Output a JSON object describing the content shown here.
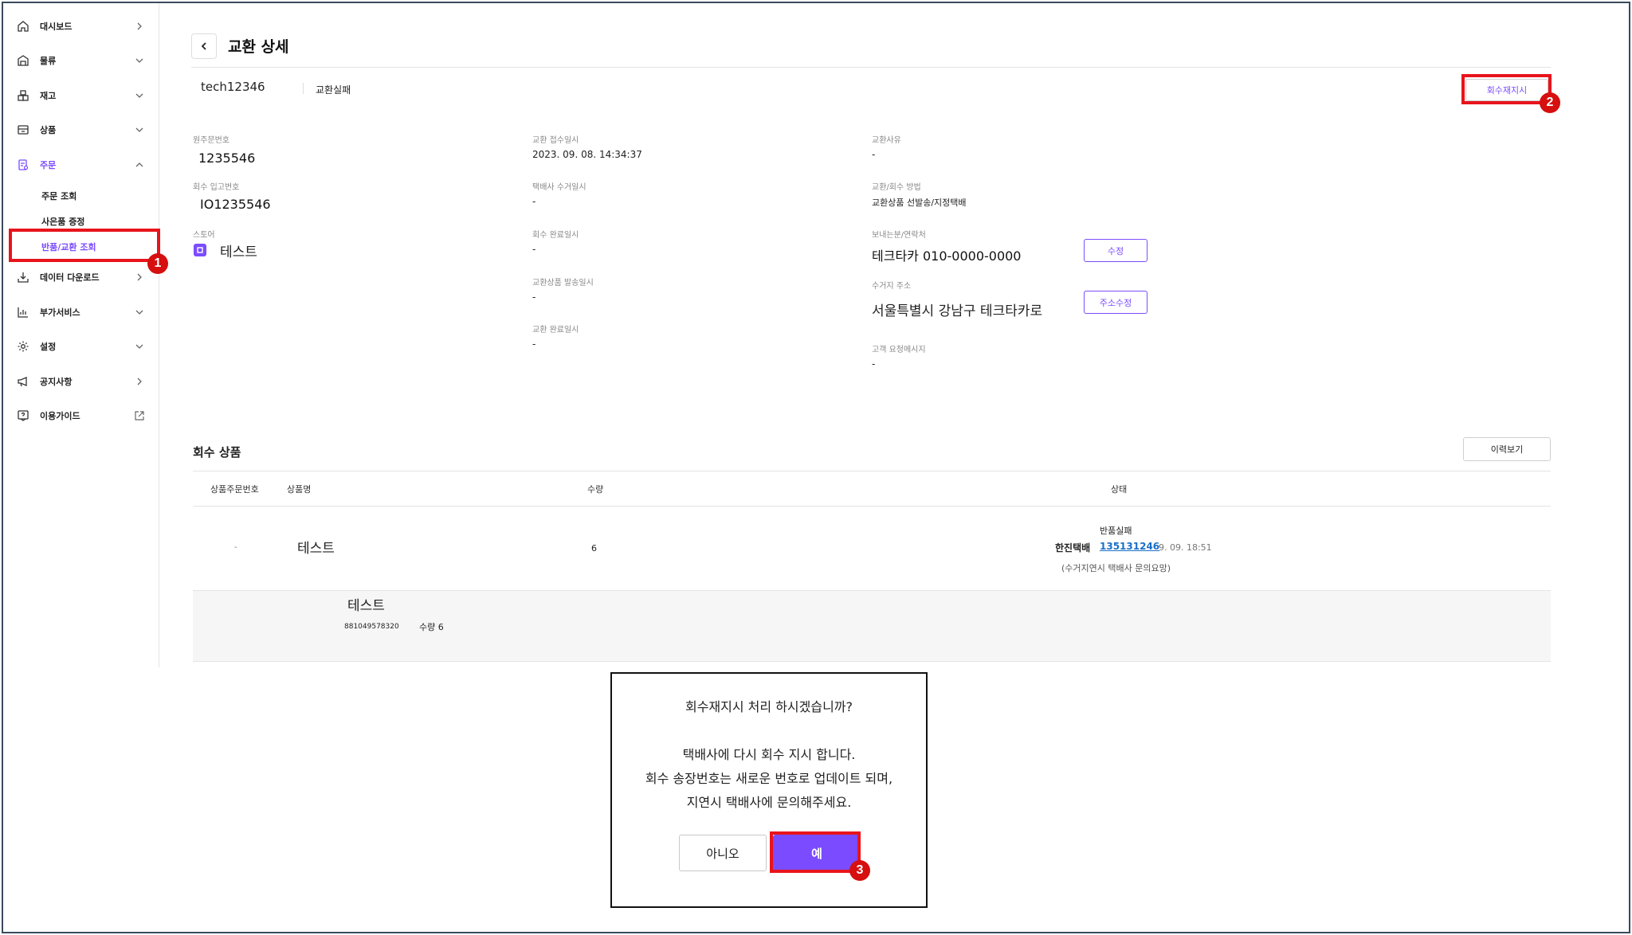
{
  "sidebar": {
    "items": [
      {
        "label": "대시보드",
        "icon": "home-icon",
        "chevron": "right"
      },
      {
        "label": "물류",
        "icon": "warehouse-icon",
        "chevron": "down"
      },
      {
        "label": "재고",
        "icon": "boxes-icon",
        "chevron": "down"
      },
      {
        "label": "상품",
        "icon": "product-icon",
        "chevron": "down"
      },
      {
        "label": "주문",
        "icon": "order-icon",
        "chevron": "up"
      },
      {
        "label": "데이터 다운로드",
        "icon": "download-icon",
        "chevron": "right"
      },
      {
        "label": "부가서비스",
        "icon": "chart-icon",
        "chevron": "down"
      },
      {
        "label": "설정",
        "icon": "gear-icon",
        "chevron": "down"
      },
      {
        "label": "공지사항",
        "icon": "megaphone-icon",
        "chevron": "right"
      },
      {
        "label": "이용가이드",
        "icon": "help-icon",
        "chevron": "external"
      }
    ],
    "sub_items": [
      "주문 조회",
      "사은품 증정",
      "반품/교환 조회"
    ]
  },
  "header": {
    "title": "교환 상세",
    "user_id": "tech12346",
    "status": "교환실패",
    "reorder_button": "회수재지시"
  },
  "details": {
    "original_order_label": "원주문번호",
    "original_order_value": "1235546",
    "return_inbound_label": "회수 입고번호",
    "return_inbound_value": "IO1235546",
    "store_label": "스토어",
    "store_value": "테스트",
    "exchange_received_label": "교환 접수일시",
    "exchange_received_value": "2023. 09. 08. 14:34:37",
    "courier_pickup_label": "택배사 수거일시",
    "courier_pickup_value": "-",
    "return_complete_label": "회수 완료일시",
    "return_complete_value": "-",
    "exchange_ship_label": "교환상품 발송일시",
    "exchange_ship_value": "-",
    "exchange_complete_label": "교환 완료일시",
    "exchange_complete_value": "-",
    "reason_label": "교환사유",
    "reason_value": "-",
    "method_label": "교환/회수 방법",
    "method_value": "교환상품 선발송/지정택배",
    "sender_label": "보내는분/연락처",
    "sender_value": "테크타카 010-0000-0000",
    "edit_button": "수정",
    "address_label": "수거지 주소",
    "address_value": "서울특별시 강남구 테크타카로",
    "address_edit_button": "주소수정",
    "message_label": "고객 요청메시지",
    "message_value": "-"
  },
  "return_items": {
    "title": "회수 상품",
    "history_button": "이력보기",
    "columns": [
      "상품주문번호",
      "상품명",
      "수량",
      "상태"
    ],
    "row": {
      "order_no": "-",
      "product": "테스트",
      "qty": "6",
      "status": "반품실패",
      "courier": "한진택배",
      "tracking": "135131246",
      "date": "9. 09. 18:51",
      "note": "(수거지연시 택배사 문의요망)"
    },
    "sub_row": {
      "product": "테스트",
      "barcode": "881049578320",
      "qty": "수량 6"
    }
  },
  "modal": {
    "question": "회수재지시 처리 하시겠습니까?",
    "line1": "택배사에 다시 회수 지시 합니다.",
    "line2": "회수 송장번호는 새로운 번호로 업데이트 되며,",
    "line3": "지연시 택배사에 문의해주세요.",
    "no": "아니오",
    "yes": "예"
  },
  "annotations": [
    "1",
    "2",
    "3"
  ],
  "colors": {
    "accent": "#7b4cff",
    "annotation": "#e8141c",
    "link": "#1a6fc7"
  }
}
